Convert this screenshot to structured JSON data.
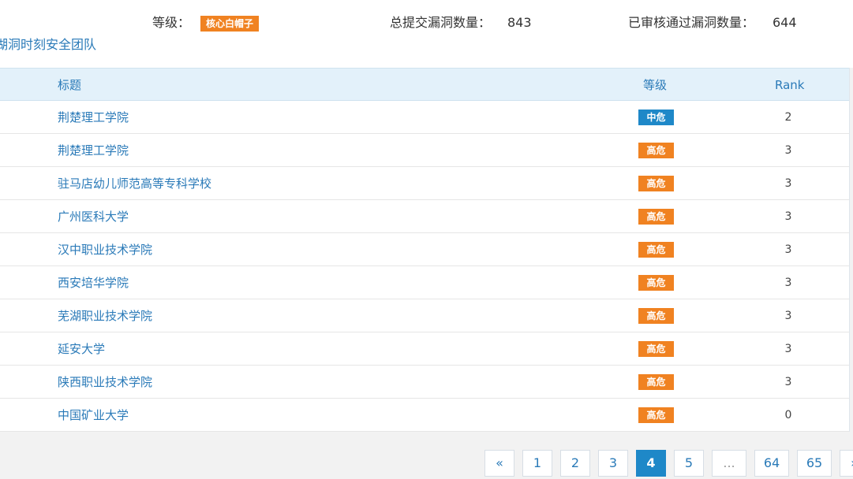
{
  "header": {
    "rank_label": "等级：",
    "rank_badge": "核心白帽子",
    "total_label": "总提交漏洞数量：",
    "total_value": "843",
    "approved_label": "已审核通过漏洞数量：",
    "approved_value": "644",
    "team_name": "湖洞时刻安全团队"
  },
  "colors": {
    "accent": "#2a7ab8",
    "high": "#f08221",
    "medium": "#1e88c8"
  },
  "table": {
    "columns": [
      "标题",
      "等级",
      "Rank"
    ],
    "rows": [
      {
        "title": "荆楚理工学院",
        "level": "中危",
        "level_type": "medium",
        "rank": "2"
      },
      {
        "title": "荆楚理工学院",
        "level": "高危",
        "level_type": "high",
        "rank": "3"
      },
      {
        "title": "驻马店幼儿师范高等专科学校",
        "level": "高危",
        "level_type": "high",
        "rank": "3"
      },
      {
        "title": "广州医科大学",
        "level": "高危",
        "level_type": "high",
        "rank": "3"
      },
      {
        "title": "汉中职业技术学院",
        "level": "高危",
        "level_type": "high",
        "rank": "3"
      },
      {
        "title": "西安培华学院",
        "level": "高危",
        "level_type": "high",
        "rank": "3"
      },
      {
        "title": "芜湖职业技术学院",
        "level": "高危",
        "level_type": "high",
        "rank": "3"
      },
      {
        "title": "延安大学",
        "level": "高危",
        "level_type": "high",
        "rank": "3"
      },
      {
        "title": "陕西职业技术学院",
        "level": "高危",
        "level_type": "high",
        "rank": "3"
      },
      {
        "title": "中国矿业大学",
        "level": "高危",
        "level_type": "high",
        "rank": "0"
      }
    ]
  },
  "pagination": {
    "prev": "«",
    "next": "»",
    "pages": [
      "1",
      "2",
      "3",
      "4",
      "5",
      "...",
      "64",
      "65"
    ],
    "current": "4"
  }
}
